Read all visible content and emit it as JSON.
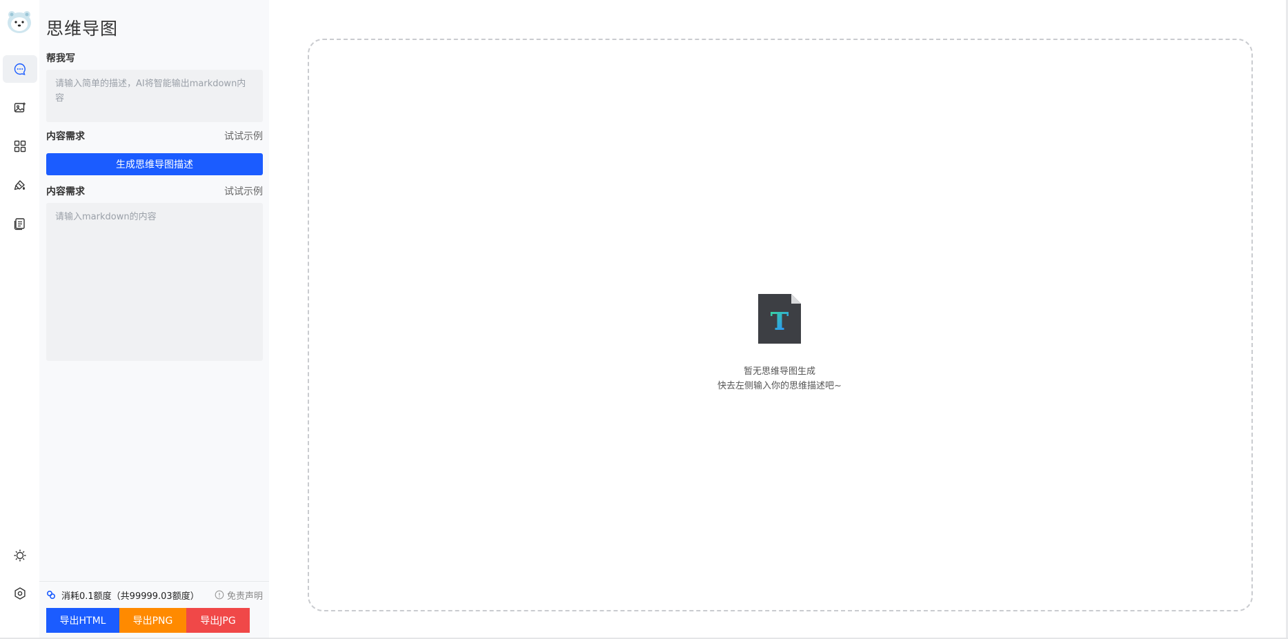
{
  "rail": {
    "logo_icon": "polar-bear-logo",
    "items": [
      {
        "name": "chat-icon",
        "active": true
      },
      {
        "name": "image-icon",
        "active": false
      },
      {
        "name": "apps-icon",
        "active": false
      },
      {
        "name": "brush-icon",
        "active": false
      },
      {
        "name": "document-icon",
        "active": false
      }
    ],
    "bottom_items": [
      {
        "name": "theme-sun-icon"
      },
      {
        "name": "settings-icon"
      }
    ]
  },
  "panel": {
    "title": "思维导图",
    "help_write_label": "帮我写",
    "prompt_input": {
      "placeholder": "请输入简单的描述，AI将智能输出markdown内容",
      "value": ""
    },
    "content_label_1": "内容需求",
    "try_example_1": "试试示例",
    "generate_button": "生成思维导图描述",
    "content_label_2": "内容需求",
    "try_example_2": "试试示例",
    "markdown_input": {
      "placeholder": "请输入markdown的内容",
      "value": ""
    },
    "credit_text": "消耗0.1额度（共99999.03额度）",
    "disclaimer": "免责声明",
    "export": {
      "html": "导出HTML",
      "png": "导出PNG",
      "jpg": "导出JPG"
    }
  },
  "canvas": {
    "empty_icon": "text-file-icon",
    "empty_title": "暂无思维导图生成",
    "empty_hint": "快去左侧输入你的思维描述吧~"
  },
  "colors": {
    "primary": "#1b5cff",
    "orange": "#ff8a00",
    "red": "#f04848",
    "panel_bg": "#f8f9fb",
    "input_bg": "#f0f1f3"
  }
}
